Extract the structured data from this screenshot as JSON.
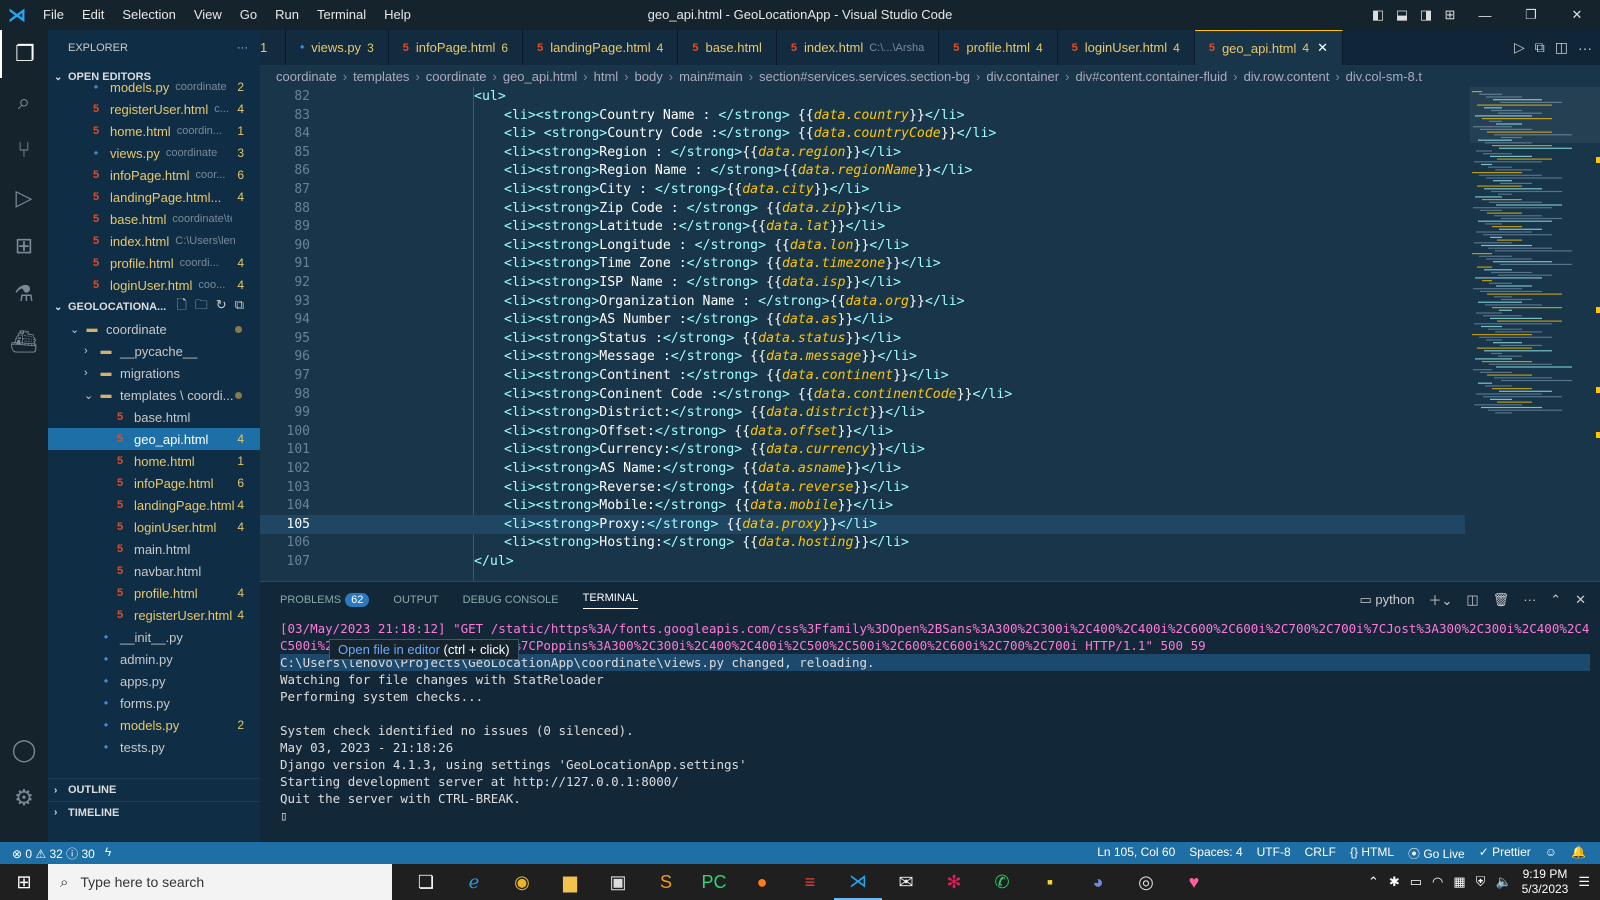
{
  "titlebar": {
    "menu": [
      "File",
      "Edit",
      "Selection",
      "View",
      "Go",
      "Run",
      "Terminal",
      "Help"
    ],
    "title": "geo_api.html - GeoLocationApp - Visual Studio Code"
  },
  "sidebar": {
    "explorer_label": "EXPLORER",
    "more": "···",
    "open_editors_label": "OPEN EDITORS",
    "open_editors": [
      {
        "name": "models.py",
        "path": "coordinate",
        "badge": "2",
        "type": "py"
      },
      {
        "name": "registerUser.html",
        "path": "c...",
        "badge": "4",
        "type": "html"
      },
      {
        "name": "home.html",
        "path": "coordin...",
        "badge": "1",
        "type": "html"
      },
      {
        "name": "views.py",
        "path": "coordinate",
        "badge": "3",
        "type": "py"
      },
      {
        "name": "infoPage.html",
        "path": "coor...",
        "badge": "6",
        "type": "html"
      },
      {
        "name": "landingPage.html...",
        "path": "",
        "badge": "4",
        "type": "html"
      },
      {
        "name": "base.html",
        "path": "coordinate\\te...",
        "badge": "",
        "type": "html"
      },
      {
        "name": "index.html",
        "path": "C:\\Users\\leno...",
        "badge": "",
        "type": "html"
      },
      {
        "name": "profile.html",
        "path": "coordi...",
        "badge": "4",
        "type": "html"
      },
      {
        "name": "loginUser.html",
        "path": "coo...",
        "badge": "4",
        "type": "html"
      },
      {
        "name": "geo_api.html",
        "path": "coord...",
        "badge": "4",
        "type": "html"
      }
    ],
    "project_label": "GEOLOCATIONA...",
    "tree": [
      {
        "name": "coordinate",
        "indent": 1,
        "kind": "folder-open",
        "badge": "",
        "dot": true
      },
      {
        "name": "__pycache__",
        "indent": 2,
        "kind": "folder",
        "badge": ""
      },
      {
        "name": "migrations",
        "indent": 2,
        "kind": "folder",
        "badge": ""
      },
      {
        "name": "templates \\ coordi...",
        "indent": 2,
        "kind": "folder-open",
        "badge": "",
        "dot": true
      },
      {
        "name": "base.html",
        "indent": 3,
        "kind": "html",
        "badge": ""
      },
      {
        "name": "geo_api.html",
        "indent": 3,
        "kind": "html",
        "badge": "4",
        "selected": true
      },
      {
        "name": "home.html",
        "indent": 3,
        "kind": "html",
        "badge": "1"
      },
      {
        "name": "infoPage.html",
        "indent": 3,
        "kind": "html",
        "badge": "6"
      },
      {
        "name": "landingPage.html",
        "indent": 3,
        "kind": "html",
        "badge": "4"
      },
      {
        "name": "loginUser.html",
        "indent": 3,
        "kind": "html",
        "badge": "4"
      },
      {
        "name": "main.html",
        "indent": 3,
        "kind": "html",
        "badge": ""
      },
      {
        "name": "navbar.html",
        "indent": 3,
        "kind": "html",
        "badge": ""
      },
      {
        "name": "profile.html",
        "indent": 3,
        "kind": "html",
        "badge": "4"
      },
      {
        "name": "registerUser.html",
        "indent": 3,
        "kind": "html",
        "badge": "4"
      },
      {
        "name": "__init__.py",
        "indent": 2,
        "kind": "py",
        "badge": ""
      },
      {
        "name": "admin.py",
        "indent": 2,
        "kind": "py",
        "badge": ""
      },
      {
        "name": "apps.py",
        "indent": 2,
        "kind": "py",
        "badge": ""
      },
      {
        "name": "forms.py",
        "indent": 2,
        "kind": "py",
        "badge": ""
      },
      {
        "name": "models.py",
        "indent": 2,
        "kind": "py",
        "badge": "2"
      },
      {
        "name": "tests.py",
        "indent": 2,
        "kind": "py",
        "badge": ""
      },
      {
        "name": "urls.py",
        "indent": 2,
        "kind": "py",
        "badge": ""
      }
    ],
    "outline_label": "OUTLINE",
    "timeline_label": "TIMELINE"
  },
  "tabs": [
    {
      "name": "1",
      "type": "",
      "count": ""
    },
    {
      "name": "views.py",
      "type": "py",
      "count": "3"
    },
    {
      "name": "infoPage.html",
      "type": "html",
      "count": "6"
    },
    {
      "name": "landingPage.html",
      "type": "html",
      "count": "4"
    },
    {
      "name": "base.html",
      "type": "html",
      "count": ""
    },
    {
      "name": "index.html",
      "type": "html",
      "count": "",
      "sub": "C:\\...\\Arsha"
    },
    {
      "name": "profile.html",
      "type": "html",
      "count": "4"
    },
    {
      "name": "loginUser.html",
      "type": "html",
      "count": "4"
    },
    {
      "name": "geo_api.html",
      "type": "html",
      "count": "4",
      "active": true
    }
  ],
  "breadcrumb": [
    "coordinate",
    "templates",
    "coordinate",
    "geo_api.html",
    "html",
    "body",
    "main#main",
    "section#services.services.section-bg",
    "div.container",
    "div#content.container-fluid",
    "div.row.content",
    "div.col-sm-8.t"
  ],
  "editor": {
    "lines": [
      {
        "n": "82",
        "label": "",
        "expr": "",
        "raw": "<ul>",
        "indent": 0
      },
      {
        "n": "83",
        "label": "Country Name : ",
        "expr": "data.country",
        "indent": 1
      },
      {
        "n": "84",
        "label": "Country Code :",
        "expr": "data.countryCode",
        "indent": 1,
        "space": true
      },
      {
        "n": "85",
        "label": "Region : ",
        "expr": "data.region",
        "indent": 1,
        "tight": true
      },
      {
        "n": "86",
        "label": "Region Name : ",
        "expr": "data.regionName",
        "indent": 1,
        "tight": true
      },
      {
        "n": "87",
        "label": "City : ",
        "expr": "data.city",
        "indent": 1,
        "tight": true
      },
      {
        "n": "88",
        "label": "Zip Code : ",
        "expr": "data.zip",
        "indent": 1
      },
      {
        "n": "89",
        "label": "Latitude :",
        "expr": "data.lat",
        "indent": 1,
        "tight": true
      },
      {
        "n": "90",
        "label": "Longitude : ",
        "expr": "data.lon",
        "indent": 1
      },
      {
        "n": "91",
        "label": "Time Zone :",
        "expr": "data.timezone",
        "indent": 1
      },
      {
        "n": "92",
        "label": "ISP Name : ",
        "expr": "data.isp",
        "indent": 1
      },
      {
        "n": "93",
        "label": "Organization Name : ",
        "expr": "data.org",
        "indent": 1,
        "tight": true
      },
      {
        "n": "94",
        "label": "AS Number :",
        "expr": "data.as",
        "indent": 1
      },
      {
        "n": "95",
        "label": "Status :",
        "expr": "data.status",
        "indent": 1
      },
      {
        "n": "96",
        "label": "Message :",
        "expr": "data.message",
        "indent": 1
      },
      {
        "n": "97",
        "label": "Continent :",
        "expr": "data.continent",
        "indent": 1
      },
      {
        "n": "98",
        "label": "Coninent Code :",
        "expr": "data.continentCode",
        "indent": 1
      },
      {
        "n": "99",
        "label": "District:",
        "expr": "data.district",
        "indent": 1
      },
      {
        "n": "100",
        "label": "Offset:",
        "expr": "data.offset",
        "indent": 1
      },
      {
        "n": "101",
        "label": "Currency:",
        "expr": "data.currency",
        "indent": 1
      },
      {
        "n": "102",
        "label": "AS Name:",
        "expr": "data.asname",
        "indent": 1
      },
      {
        "n": "103",
        "label": "Reverse:",
        "expr": "data.reverse",
        "indent": 1
      },
      {
        "n": "104",
        "label": "Mobile:",
        "expr": "data.mobile",
        "indent": 1
      },
      {
        "n": "105",
        "label": "Proxy:",
        "expr": "data.proxy",
        "indent": 1,
        "current": true
      },
      {
        "n": "106",
        "label": "Hosting:",
        "expr": "data.hosting",
        "indent": 1
      },
      {
        "n": "107",
        "label": "",
        "expr": "",
        "raw": "</ul>",
        "indent": 0
      }
    ]
  },
  "panel": {
    "tabs": [
      "PROBLEMS",
      "OUTPUT",
      "DEBUG CONSOLE",
      "TERMINAL"
    ],
    "problems_count": "62",
    "terminal_kind": "python",
    "tooltip_text": "Open file in editor",
    "tooltip_shortcut": "(ctrl + click)",
    "terminal_lines": [
      "[03/May/2023 21:18:12] \"GET /static/https%3A/fonts.googleapis.com/css%3Ffamily%3DOpen%2BSans%3A300%2C300i%2C400%2C400i%2C600%2C600i%2C700%2C700i%7CJost%3A300%2C300i%2C400%2C400i%2C500%2",
      "C500i%2C600%2C600i%2C700%2C700i%7CPoppins%3A300%2C300i%2C400%2C400i%2C500%2C500i%2C600%2C600i%2C700%2C700i HTTP/1.1\" 500 59",
      "C:\\Users\\lenovo\\Projects\\GeoLocationApp\\coordinate\\views.py changed, reloading.",
      "Watching for file changes with StatReloader",
      "Performing system checks...",
      "",
      "System check identified no issues (0 silenced).",
      "May 03, 2023 - 21:18:26",
      "Django version 4.1.3, using settings 'GeoLocationApp.settings'",
      "Starting development server at http://127.0.0.1:8000/",
      "Quit the server with CTRL-BREAK.",
      "▯"
    ]
  },
  "status": {
    "errors": "⊗ 0 ⚠ 32 ⓘ 30",
    "position": "Ln 105, Col 60",
    "spaces": "Spaces: 4",
    "encoding": "UTF-8",
    "eol": "CRLF",
    "language": "{} HTML",
    "golive": "⦿ Go Live",
    "prettier": "✓ Prettier"
  },
  "taskbar": {
    "search_placeholder": "Type here to search",
    "time": "9:19 PM",
    "date": "5/3/2023"
  }
}
